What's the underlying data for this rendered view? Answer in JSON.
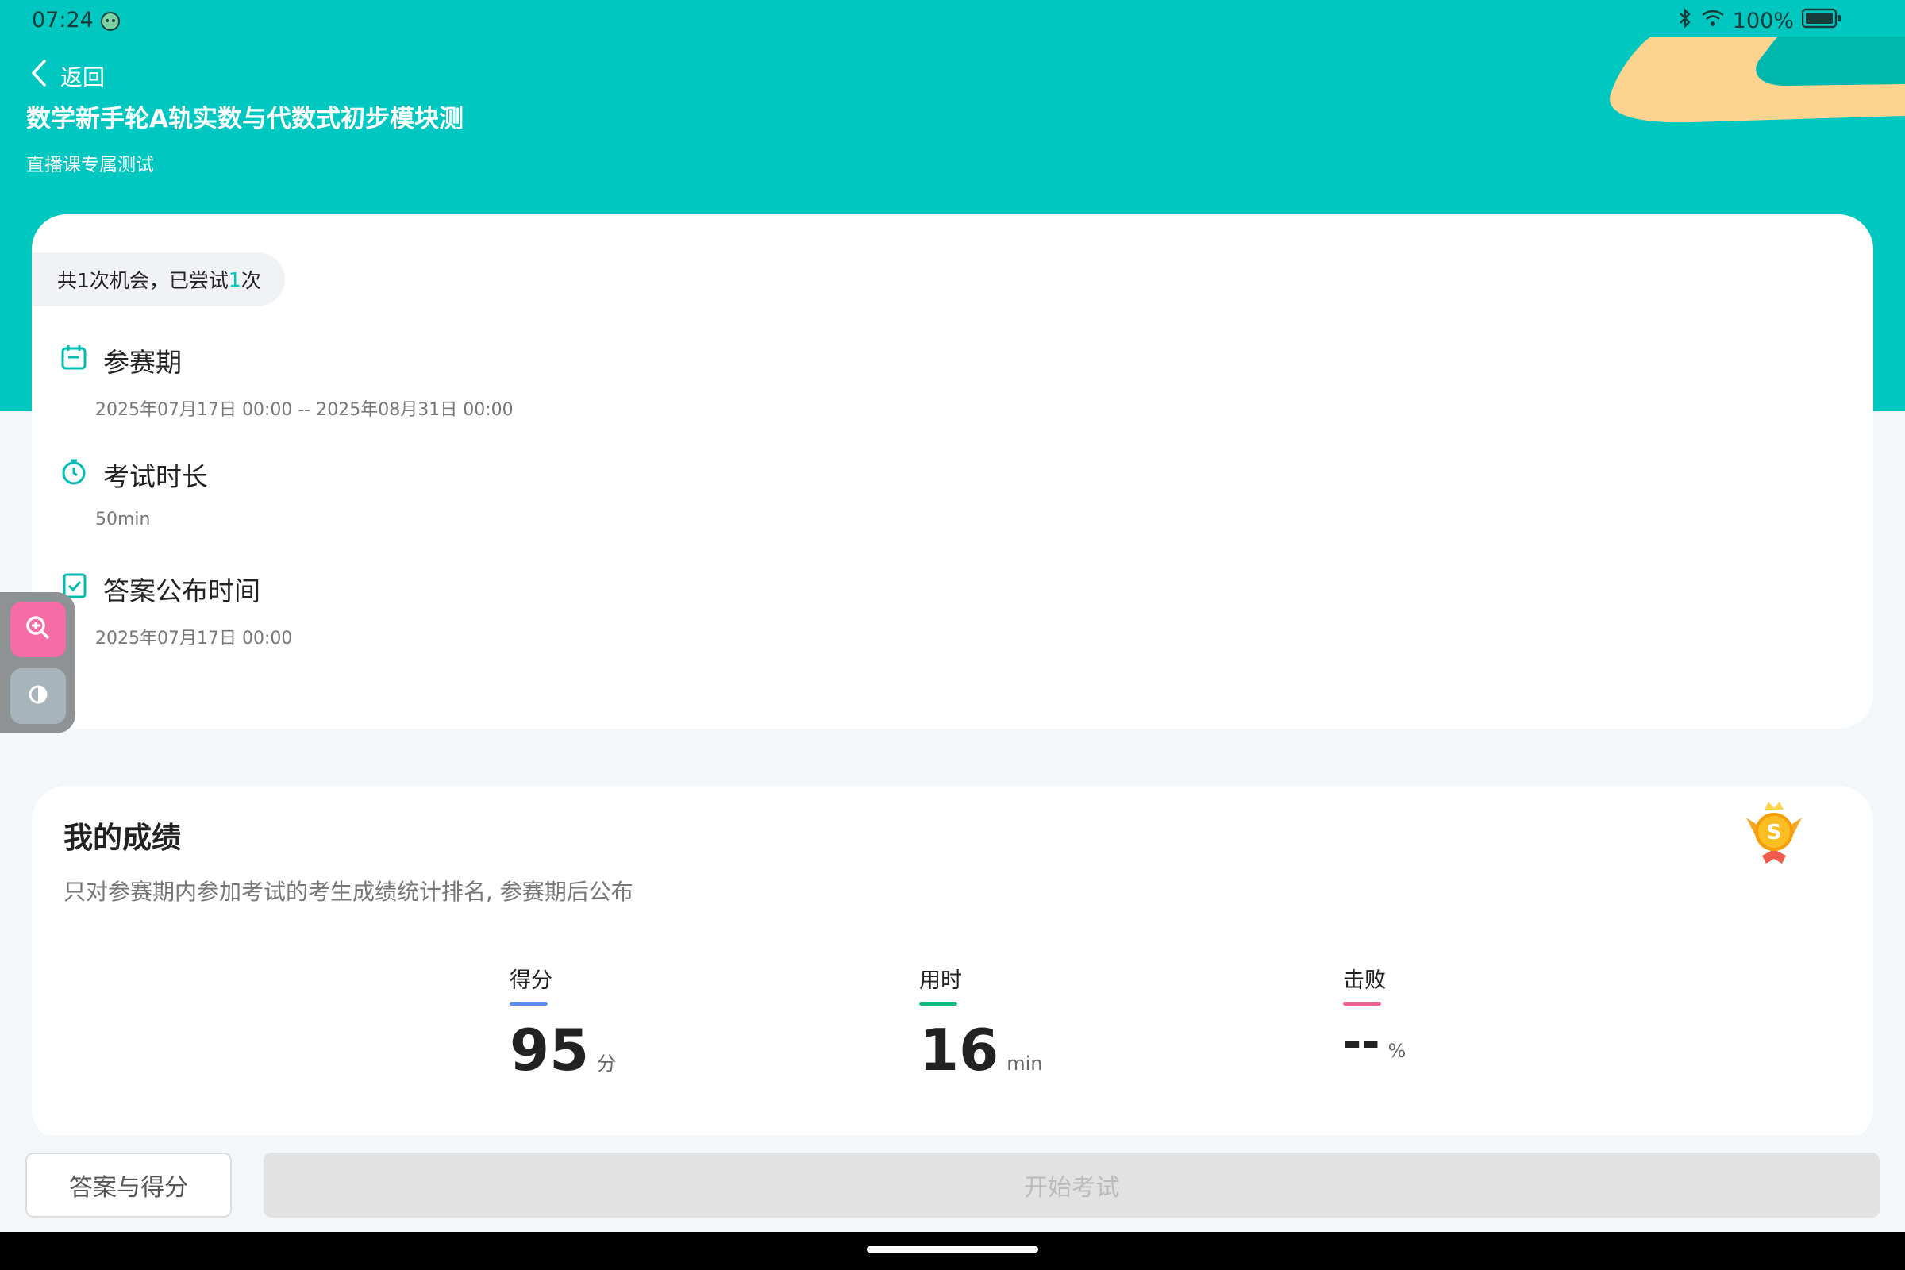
{
  "status_bar": {
    "time": "07:24",
    "battery": "100%"
  },
  "header": {
    "back_label": "返回",
    "title": "数学新手轮A轨实数与代数式初步模块测",
    "subtitle": "直播课专属测试"
  },
  "info_card": {
    "attempts_prefix": "共1次机会，已尝试",
    "attempts_count": "1",
    "attempts_suffix": "次",
    "items": [
      {
        "label": "参赛期",
        "value": "2025年07月17日 00:00  --  2025年08月31日 00:00",
        "icon": "calendar-icon"
      },
      {
        "label": "考试时长",
        "value": "50min",
        "icon": "stopwatch-icon"
      },
      {
        "label": "答案公布时间",
        "value": "2025年07月17日 00:00",
        "icon": "checklist-icon"
      }
    ]
  },
  "score_card": {
    "title": "我的成绩",
    "description": "只对参赛期内参加考试的考生成绩统计排名, 参赛期后公布",
    "stats": [
      {
        "label": "得分",
        "value": "95",
        "unit": "分",
        "color": "#5b8def"
      },
      {
        "label": "用时",
        "value": "16",
        "unit": "min",
        "color": "#10b981"
      },
      {
        "label": "击败",
        "value": "--",
        "unit": "%",
        "color": "#f06292"
      }
    ]
  },
  "actions": {
    "answers_button": "答案与得分",
    "start_button": "开始考试"
  },
  "colors": {
    "accent": "#00c8c1",
    "zoom_tool": "#f56ca6",
    "contrast_tool": "#a7b4bc"
  }
}
